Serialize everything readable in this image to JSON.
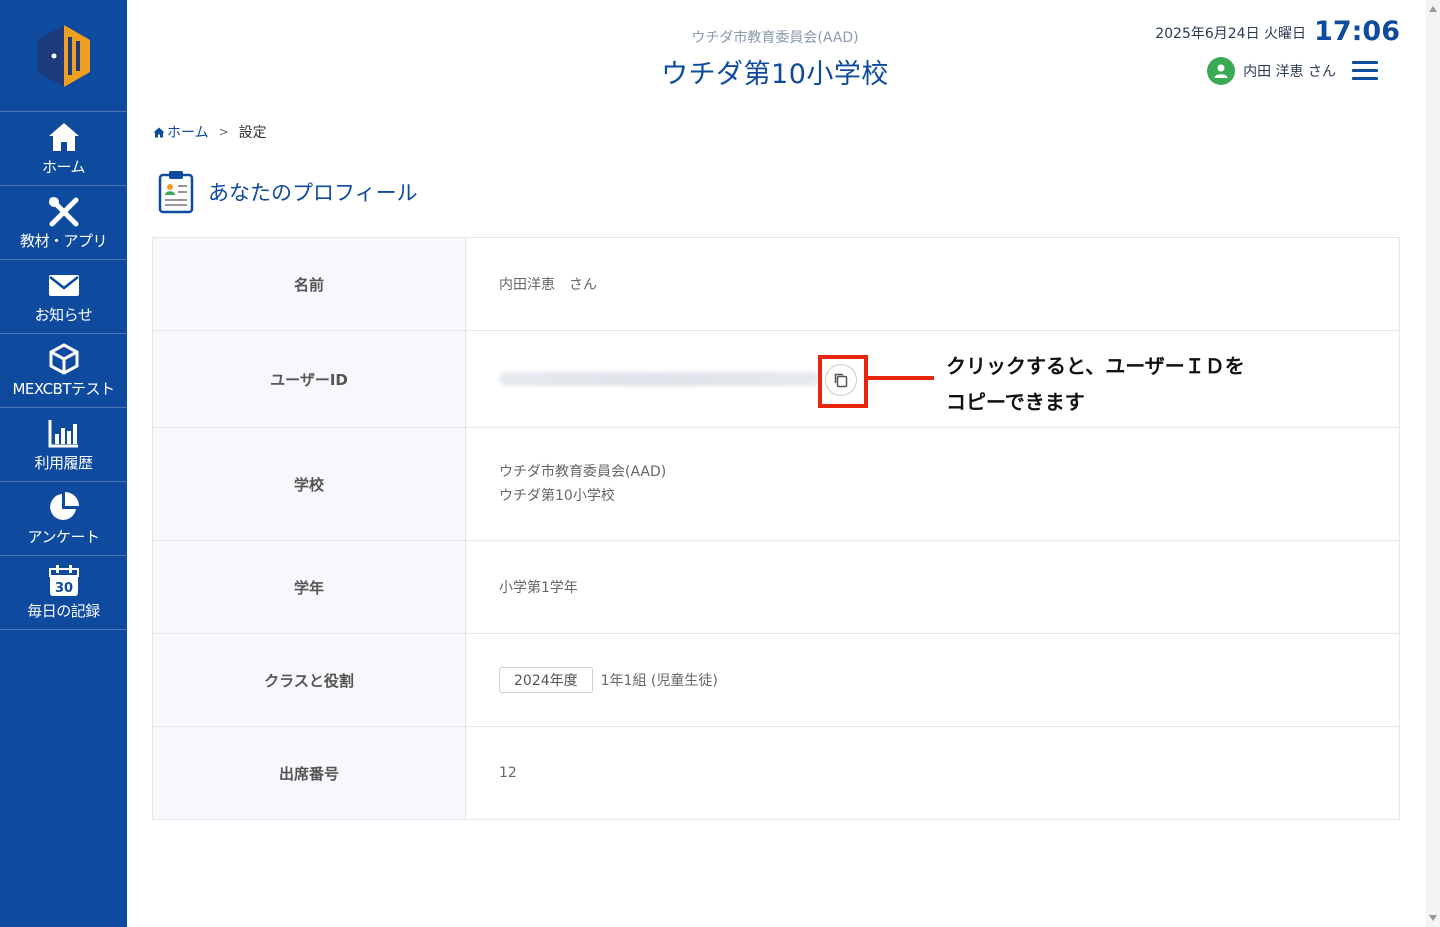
{
  "sidebar": {
    "items": [
      {
        "label": "ホーム"
      },
      {
        "label": "教材・アプリ"
      },
      {
        "label": "お知らせ"
      },
      {
        "label": "MEXCBTテスト"
      },
      {
        "label": "利用履歴"
      },
      {
        "label": "アンケート"
      },
      {
        "label": "毎日の記録"
      }
    ],
    "calendar_day": "30"
  },
  "header": {
    "org": "ウチダ市教育委員会(AAD)",
    "school": "ウチダ第10小学校",
    "date": "2025年6月24日 火曜日",
    "time": "17:06",
    "user_name": "内田 洋恵 さん"
  },
  "breadcrumb": {
    "home": "ホーム",
    "separator": ">",
    "current": "設定"
  },
  "page": {
    "title": "あなたのプロフィール"
  },
  "profile": {
    "rows": [
      {
        "label": "名前",
        "value": "内田洋恵　さん"
      },
      {
        "label": "ユーザーID",
        "value": ""
      },
      {
        "label": "学校",
        "value_line1": "ウチダ市教育委員会(AAD)",
        "value_line2": "ウチダ第10小学校"
      },
      {
        "label": "学年",
        "value": "小学第1学年"
      },
      {
        "label": "クラスと役割",
        "badge": "2024年度",
        "value": "1年1組 (児童生徒)"
      },
      {
        "label": "出席番号",
        "value": "12"
      }
    ]
  },
  "callout": {
    "line1": "クリックすると、ユーザーＩＤを",
    "line2": "コピーできます"
  },
  "colors": {
    "sidebar": "#0e4a9e",
    "accent": "#0e4a9e",
    "highlight": "#e8260e",
    "avatar": "#3aaa55"
  }
}
